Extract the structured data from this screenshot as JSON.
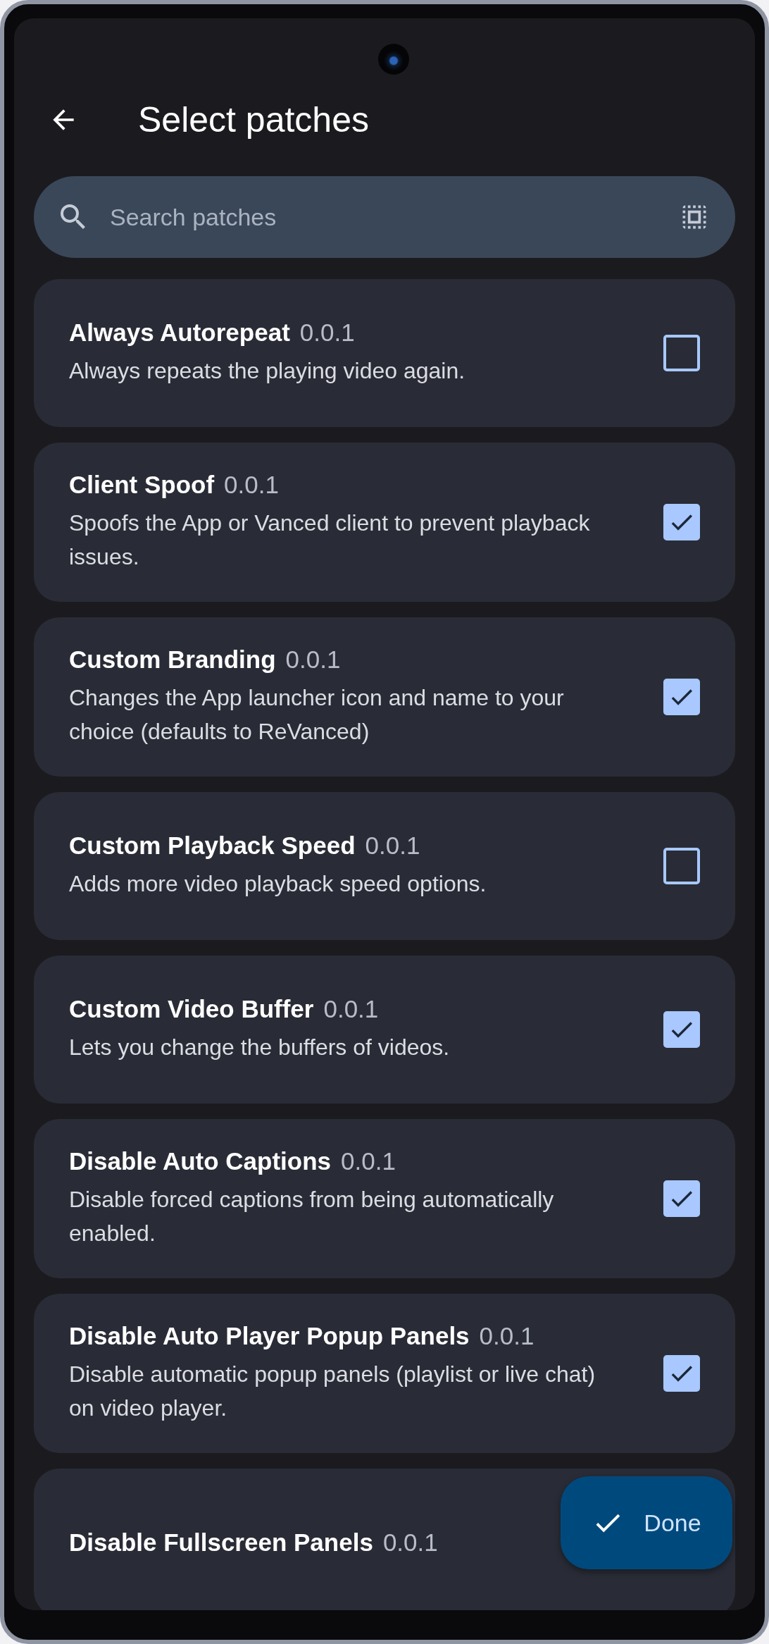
{
  "header": {
    "title": "Select patches"
  },
  "search": {
    "placeholder": "Search patches"
  },
  "patches": [
    {
      "name": "Always Autorepeat",
      "version": "0.0.1",
      "description": "Always repeats the playing video again.",
      "checked": false
    },
    {
      "name": "Client Spoof",
      "version": "0.0.1",
      "description": "Spoofs the App or Vanced client to prevent playback issues.",
      "checked": true
    },
    {
      "name": "Custom Branding",
      "version": "0.0.1",
      "description": "Changes the App launcher icon and name to your choice (defaults to ReVanced)",
      "checked": true
    },
    {
      "name": "Custom Playback Speed",
      "version": "0.0.1",
      "description": "Adds more video playback speed options.",
      "checked": false
    },
    {
      "name": "Custom Video Buffer",
      "version": "0.0.1",
      "description": "Lets you change the buffers of videos.",
      "checked": true
    },
    {
      "name": "Disable Auto Captions",
      "version": "0.0.1",
      "description": "Disable forced captions from being automatically enabled.",
      "checked": true
    },
    {
      "name": "Disable Auto Player Popup Panels",
      "version": "0.0.1",
      "description": "Disable automatic popup panels (playlist or live chat) on video player.",
      "checked": true
    },
    {
      "name": "Disable Fullscreen Panels",
      "version": "0.0.1"
    }
  ],
  "done_button": {
    "label": "Done"
  }
}
